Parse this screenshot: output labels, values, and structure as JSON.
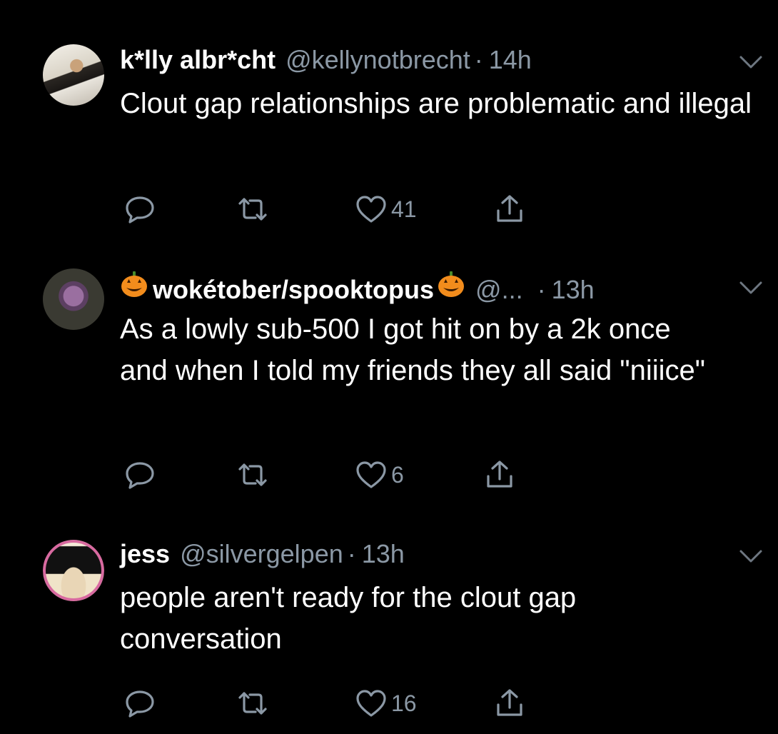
{
  "tweets": [
    {
      "name": "k*lly albr*cht",
      "handle": "@kellynotbrecht",
      "dot": "·",
      "time": "14h",
      "text": "Clout gap relationships are problematic and illegal",
      "likes": "41",
      "avatar_icon": "avatar-photo"
    },
    {
      "name": "wokétober/spooktopus",
      "name_prefix_icon": "jack-o-lantern-icon",
      "name_suffix_icon": "jack-o-lantern-icon",
      "handle": "@...",
      "dot": "·",
      "time": "13h",
      "text": "As a lowly sub-500 I got hit on by a 2k once and when I told my friends they all said \"niiice\"",
      "likes": "6",
      "avatar_icon": "octopus-avatar"
    },
    {
      "name": "jess",
      "handle": "@silvergelpen",
      "dot": "·",
      "time": "13h",
      "text": "people aren't ready for the clout gap conversation",
      "likes": "16",
      "avatar_icon": "avatar-photo"
    }
  ],
  "colors": {
    "background": "#000000",
    "text": "#ffffff",
    "secondary": "#8b98a5",
    "pumpkin": "#f28c1c"
  }
}
